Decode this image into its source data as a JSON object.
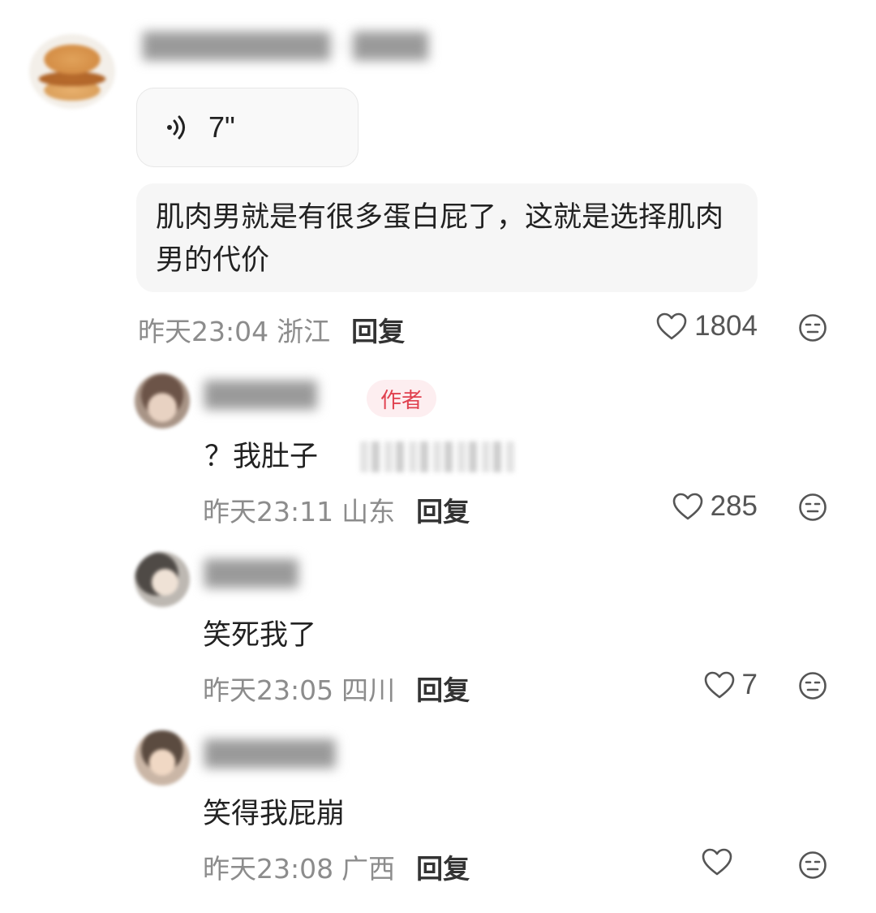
{
  "main_comment": {
    "voice_duration": "7\"",
    "text": "肌肉男就是有很多蛋白屁了，这就是选择肌肉男的代价",
    "time": "昨天23:04",
    "location": "浙江",
    "reply_label": "回复",
    "likes": "1804"
  },
  "replies": [
    {
      "badge": "作者",
      "text": "？我肚子",
      "time": "昨天23:11",
      "location": "山东",
      "reply_label": "回复",
      "likes": "285"
    },
    {
      "text": "笑死我了",
      "time": "昨天23:05",
      "location": "四川",
      "reply_label": "回复",
      "likes": "7"
    },
    {
      "text": "笑得我屁崩",
      "time": "昨天23:08",
      "location": "广西",
      "reply_label": "回复",
      "likes": ""
    }
  ],
  "icons": {
    "voice": "voice-wave-icon",
    "like": "heart-outline-icon",
    "dislike": "neutral-face-icon"
  },
  "colors": {
    "author_badge_bg": "#fdeef0",
    "author_badge_text": "#e0414f",
    "meta_text": "#8c8c8c"
  }
}
